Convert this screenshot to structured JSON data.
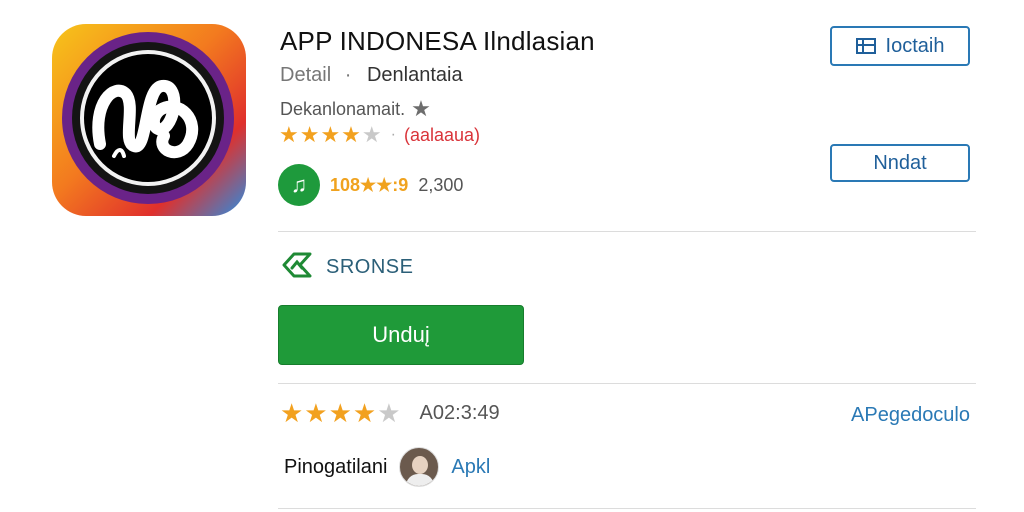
{
  "app": {
    "icon": "app-logo-icon",
    "title": "APP INDONESA Ilndlasian",
    "detail_label": "Detail",
    "separator": "·",
    "category": "Denlantaia",
    "developer": "Dekanlonamait.",
    "developer_icon": "star-icon"
  },
  "rating": {
    "stars": "★★★★",
    "half_star": "★",
    "dot": "·",
    "count_text": "(aalaaua)",
    "value": 4.5
  },
  "music": {
    "icon": "music-note-icon",
    "stat": "108★★:9",
    "sub": "2,300"
  },
  "buttons": {
    "top_label": "Ioctaih",
    "top_icon": "window-icon",
    "mid_label": "Nndat"
  },
  "browse": {
    "icon": "browse-icon",
    "label": "SRONSE"
  },
  "download": {
    "label": "Unduį"
  },
  "bottom": {
    "stars": "★★★★",
    "half_star": "★",
    "code": "A02:3:49",
    "publisher_link": "APegedoculo",
    "developer_label": "Pinogatilani",
    "avatar": "developer-avatar",
    "apk_label": "Apkl"
  },
  "colors": {
    "accent_green": "#1f9a39",
    "star_orange": "#f2a11f",
    "link_blue": "#2a79b5",
    "count_red": "#d9343a"
  }
}
